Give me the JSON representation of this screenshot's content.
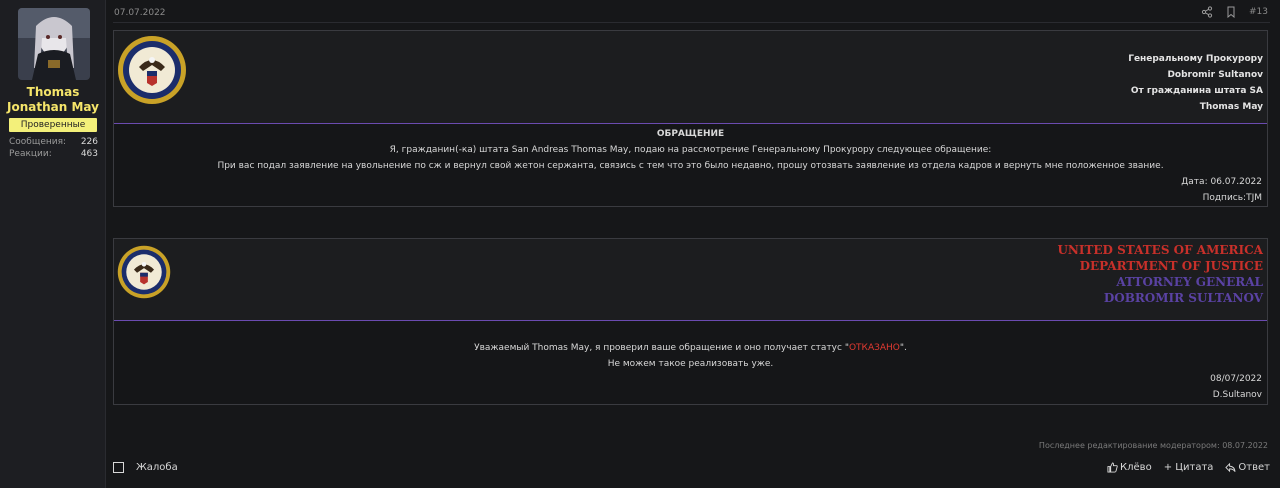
{
  "user": {
    "name": "Thomas Jonathan May",
    "role": "Проверенные",
    "stats": [
      {
        "label": "Сообщения:",
        "value": "226"
      },
      {
        "label": "Реакции:",
        "value": "463"
      }
    ]
  },
  "post": {
    "date": "07.07.2022",
    "number": "#13",
    "edited": "Последнее редактирование модератором: 08.07.2022"
  },
  "appeal": {
    "header_lines": [
      "Генеральному Прокурору",
      "Dobromir Sultanov",
      "От гражданина штата SA",
      "Thomas May"
    ],
    "title": "ОБРАЩЕНИЕ",
    "line1": "Я, гражданин(-ка) штата San Andreas Thomas May, подаю на рассмотрение Генеральному Прокурору следующее обращение:",
    "line2": "При вас подал заявление на увольнение по сж и вернул свой жетон сержанта, связись с тем что это было недавно, прошу отозвать заявление из отдела кадров и вернуть мне положенное звание.",
    "date": "Дата: 06.07.2022",
    "signature": "Подпись:TJM"
  },
  "response": {
    "header_lines": [
      "UNITED STATES OF AMERICA",
      "DEPARTMENT OF JUSTICE",
      "ATTORNEY GENERAL",
      "DOBROMIR SULTANOV"
    ],
    "line1_prefix": "Уважаемый Thomas May, я проверил ваше обращение и оно получает статус \"",
    "status": "ОТКАЗАНО",
    "line1_suffix": "\".",
    "line2": "Не можем такое реализовать уже.",
    "date": "08/07/2022",
    "signature": "D.Sultanov"
  },
  "footer": {
    "report": "Жалоба",
    "like": "Клёво",
    "quote": "+ Цитата",
    "reply": "Ответ"
  },
  "colors": {
    "username": "#f5e56a",
    "badge": "#f3f07a",
    "divider": "#6b4bb0",
    "red": "#c8302a",
    "purple": "#5a42a3"
  },
  "icons": [
    "share-icon",
    "bookmark-icon",
    "checkbox-icon",
    "like-icon",
    "reply-icon",
    "doj-seal"
  ]
}
